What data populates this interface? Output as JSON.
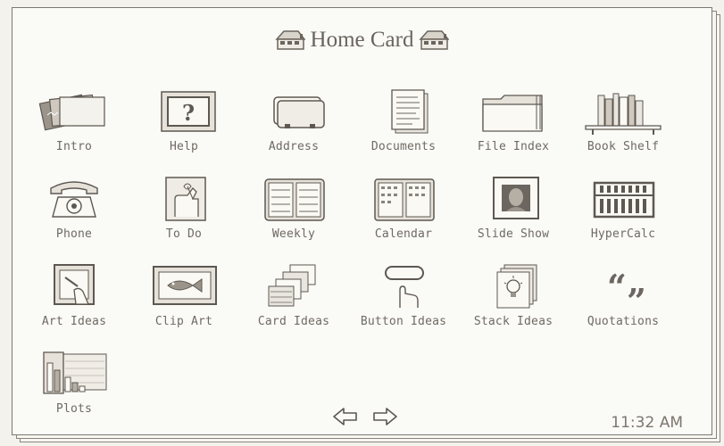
{
  "card": {
    "title": "Home Card",
    "time": "11:32 AM"
  },
  "icons": [
    {
      "label": "Intro",
      "icon": "intro-cards-icon"
    },
    {
      "label": "Help",
      "icon": "help-question-icon"
    },
    {
      "label": "Address",
      "icon": "rolodex-address-icon"
    },
    {
      "label": "Documents",
      "icon": "documents-icon"
    },
    {
      "label": "File Index",
      "icon": "file-folder-icon"
    },
    {
      "label": "Book Shelf",
      "icon": "bookshelf-icon"
    },
    {
      "label": "Phone",
      "icon": "telephone-icon"
    },
    {
      "label": "To Do",
      "icon": "todo-finger-icon"
    },
    {
      "label": "Weekly",
      "icon": "weekly-planner-icon"
    },
    {
      "label": "Calendar",
      "icon": "calendar-icon"
    },
    {
      "label": "Slide Show",
      "icon": "slide-show-icon"
    },
    {
      "label": "HyperCalc",
      "icon": "abacus-calculator-icon"
    },
    {
      "label": "Art Ideas",
      "icon": "art-frame-icon"
    },
    {
      "label": "Clip Art",
      "icon": "fish-clip-art-icon"
    },
    {
      "label": "Card Ideas",
      "icon": "card-stack-icon"
    },
    {
      "label": "Button Ideas",
      "icon": "button-press-icon"
    },
    {
      "label": "Stack Ideas",
      "icon": "lightbulb-stack-icon"
    },
    {
      "label": "Quotations",
      "icon": "quotation-marks-icon"
    },
    {
      "label": "Plots",
      "icon": "bar-plot-icon"
    }
  ],
  "colors": {
    "ink": "#6b6660",
    "paper": "#fafaf6"
  }
}
